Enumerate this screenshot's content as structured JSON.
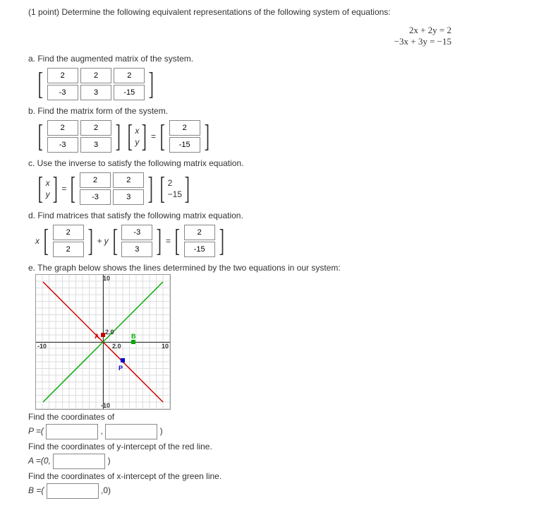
{
  "header": {
    "points_label": "(1 point) Determine the following equivalent representations of the following system of equations:",
    "eq1": "2x + 2y = 2",
    "eq2": "−3x + 3y = −15"
  },
  "parts": {
    "a": {
      "label": "a. Find the augmented matrix of the system.",
      "m11": "2",
      "m12": "2",
      "m13": "2",
      "m21": "-3",
      "m22": "3",
      "m23": "-15"
    },
    "b": {
      "label": "b. Find the matrix form of the system.",
      "m11": "2",
      "m12": "2",
      "m21": "-3",
      "m22": "3",
      "vx": "x",
      "vy": "y",
      "r1": "2",
      "r2": "-15"
    },
    "c": {
      "label": "c. Use the inverse to satisfy the following matrix equation.",
      "vx": "x",
      "vy": "y",
      "m11": "2",
      "m12": "2",
      "m21": "-3",
      "m22": "3",
      "r1": "2",
      "r2": "−15"
    },
    "d": {
      "label": "d. Find matrices that satisfy the following matrix equation.",
      "plus_y": "+ y",
      "l1": "2",
      "l2": "2",
      "r11": "-3",
      "r12": "3",
      "res1": "2",
      "res2": "-15",
      "xvar": "x"
    },
    "e": {
      "label": "e. The graph below shows the lines determined by the two equations in our system:",
      "top": "10",
      "left": "-10",
      "right": "10",
      "bottom": "-10",
      "origin_a": "2.0",
      "origin_b": "2.0",
      "pt_a": "A",
      "pt_b": "B",
      "pt_p": "P"
    },
    "f": {
      "find_coords": "Find the coordinates of",
      "P_eq": "P =(",
      "comma": ",",
      "paren": ")",
      "red_label": "Find the coordinates of y-intercept of the red line.",
      "A_eq": "A =(0,",
      "green_label": "Find the coordinates of x-intercept of the green line.",
      "B_eq": "B =(",
      "zero_paren": ",0)"
    }
  }
}
